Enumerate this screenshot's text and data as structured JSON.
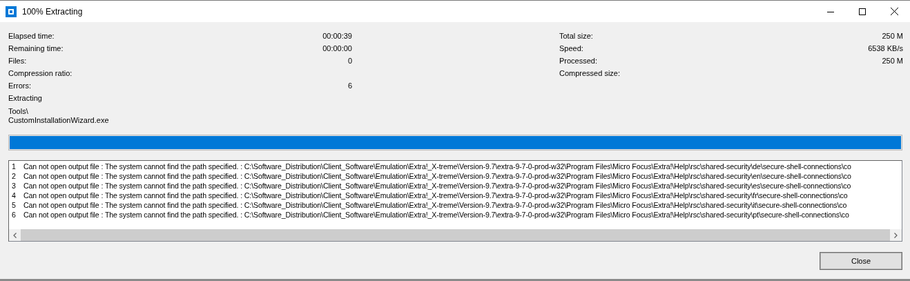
{
  "window": {
    "title": "100% Extracting"
  },
  "stats_left": [
    {
      "label": "Elapsed time:",
      "value": "00:00:39"
    },
    {
      "label": "Remaining time:",
      "value": "00:00:00"
    },
    {
      "label": "Files:",
      "value": "0"
    },
    {
      "label": "Compression ratio:"
    },
    {
      "label": "Errors:",
      "value": "6"
    }
  ],
  "stats_right": [
    {
      "label": "Total size:",
      "value": "250 M"
    },
    {
      "label": "Speed:",
      "value": "6538 KB/s"
    },
    {
      "label": "Processed:",
      "value": "250 M"
    },
    {
      "label": "Compressed size:"
    }
  ],
  "status": "Extracting",
  "current_path": "Tools\\",
  "current_file": "CustomInstallationWizard.exe",
  "progress": {
    "level": 1
  },
  "log": [
    {
      "number": "1",
      "message": "Can not open output file : The system cannot find the path specified. : C:\\Software_Distribution\\Client_Software\\Emulation\\Extra!_X-treme\\Version-9.7\\extra-9-7-0-prod-w32\\Program Files\\Micro Focus\\Extra!\\Help\\rsc\\shared-security\\de\\secure-shell-connections\\co"
    },
    {
      "number": "2",
      "message": "Can not open output file : The system cannot find the path specified. : C:\\Software_Distribution\\Client_Software\\Emulation\\Extra!_X-treme\\Version-9.7\\extra-9-7-0-prod-w32\\Program Files\\Micro Focus\\Extra!\\Help\\rsc\\shared-security\\en\\secure-shell-connections\\co"
    },
    {
      "number": "3",
      "message": "Can not open output file : The system cannot find the path specified. : C:\\Software_Distribution\\Client_Software\\Emulation\\Extra!_X-treme\\Version-9.7\\extra-9-7-0-prod-w32\\Program Files\\Micro Focus\\Extra!\\Help\\rsc\\shared-security\\es\\secure-shell-connections\\co"
    },
    {
      "number": "4",
      "message": "Can not open output file : The system cannot find the path specified. : C:\\Software_Distribution\\Client_Software\\Emulation\\Extra!_X-treme\\Version-9.7\\extra-9-7-0-prod-w32\\Program Files\\Micro Focus\\Extra!\\Help\\rsc\\shared-security\\fr\\secure-shell-connections\\co"
    },
    {
      "number": "5",
      "message": "Can not open output file : The system cannot find the path specified. : C:\\Software_Distribution\\Client_Software\\Emulation\\Extra!_X-treme\\Version-9.7\\extra-9-7-0-prod-w32\\Program Files\\Micro Focus\\Extra!\\Help\\rsc\\shared-security\\it\\secure-shell-connections\\co"
    },
    {
      "number": "6",
      "message": "Can not open output file : The system cannot find the path specified. : C:\\Software_Distribution\\Client_Software\\Emulation\\Extra!_X-treme\\Version-9.7\\extra-9-7-0-prod-w32\\Program Files\\Micro Focus\\Extra!\\Help\\rsc\\shared-security\\pt\\secure-shell-connections\\co"
    }
  ],
  "buttons": [
    "Close"
  ]
}
